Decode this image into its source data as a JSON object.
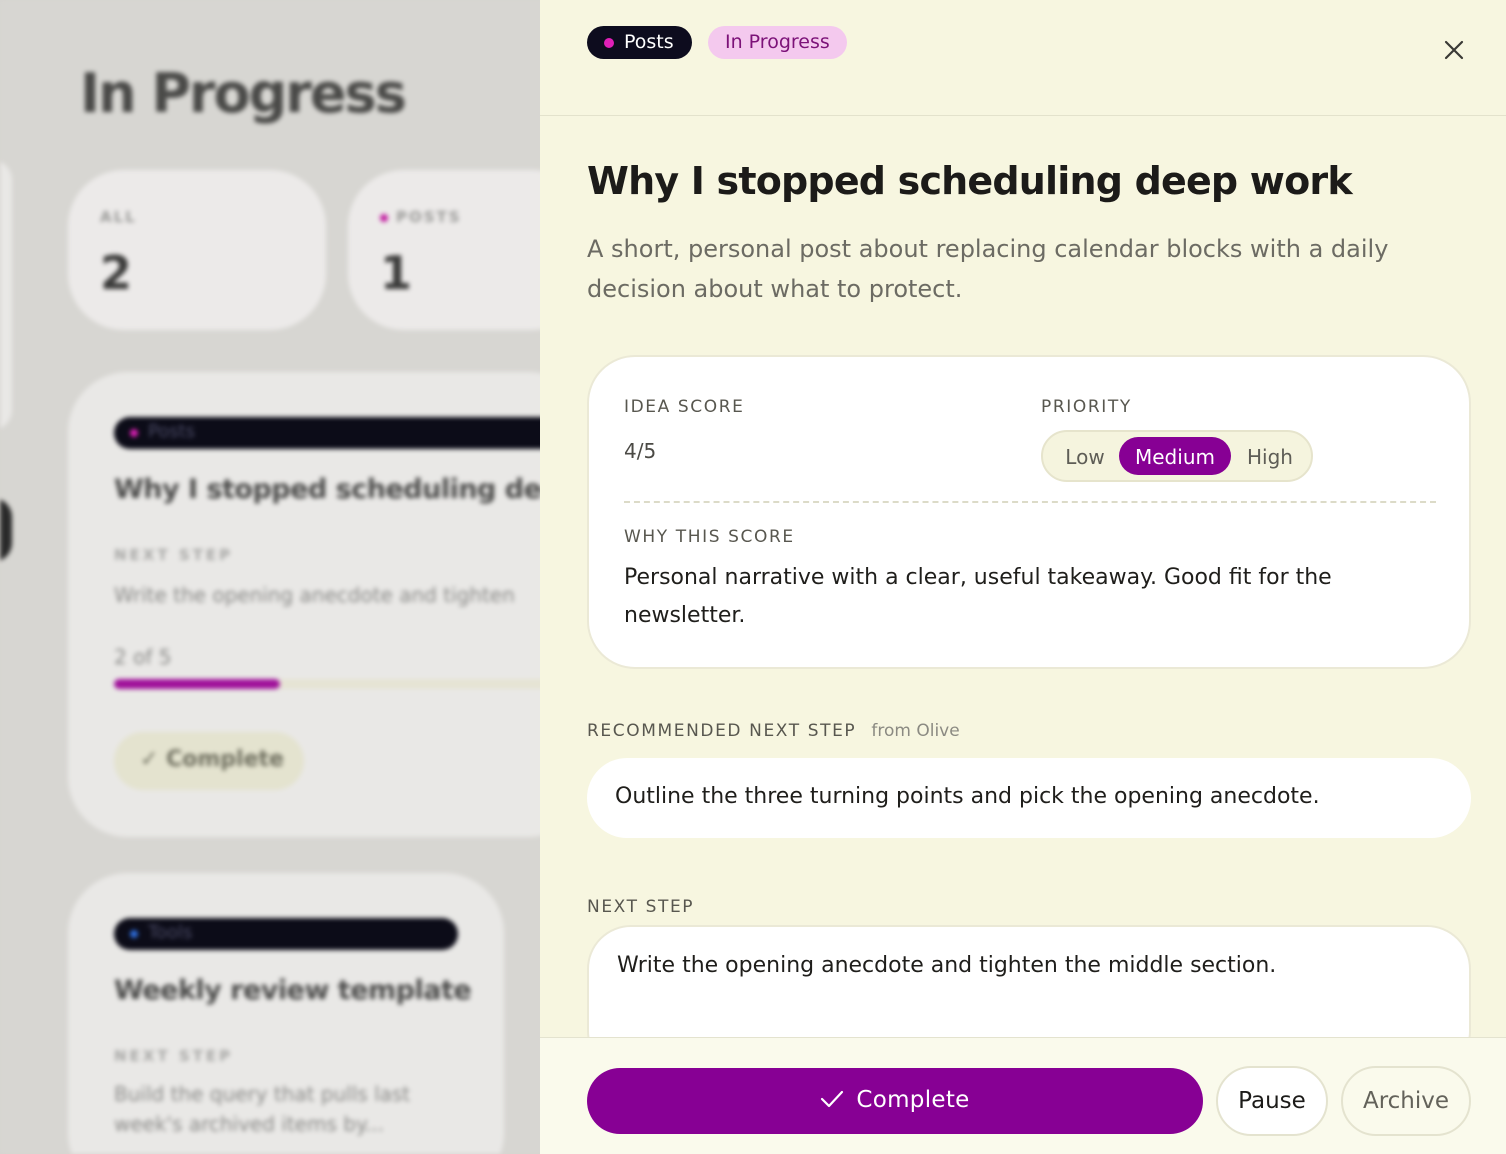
{
  "background": {
    "page_title": "In Progress",
    "stats": [
      {
        "label": "ALL",
        "value": "2"
      },
      {
        "label": "POSTS",
        "value": "1"
      }
    ],
    "cards": [
      {
        "tag": "Posts",
        "tag_color": "#e020b8",
        "title": "Why I stopped scheduling deep work",
        "caption": "NEXT STEP",
        "next_step": "Write the opening anecdote and tighten",
        "progress_text": "2 of 5",
        "progress": 0.4,
        "action": "Complete"
      },
      {
        "tag": "Tools",
        "tag_color": "#2f6fe0",
        "title": "Weekly review template",
        "caption": "NEXT STEP",
        "next_step_line1": "Build the query that pulls last",
        "next_step_line2": "week's archived items by..."
      }
    ]
  },
  "panel": {
    "tags": {
      "type": "Posts",
      "status": "In Progress"
    },
    "title": "Why I stopped scheduling deep work",
    "description": "A short, personal post about replacing calendar blocks with a daily decision about what to protect.",
    "score_card": {
      "idea_score_label": "IDEA SCORE",
      "idea_score_value": "4/5",
      "priority_label": "PRIORITY",
      "priority_options": [
        "Low",
        "Medium",
        "High"
      ],
      "priority_selected": "Medium",
      "why_label": "WHY THIS SCORE",
      "why_text": "Personal narrative with a clear, useful takeaway. Good fit for the newsletter."
    },
    "recommended": {
      "label": "RECOMMENDED NEXT STEP",
      "from": "from Olive",
      "text": "Outline the three turning points and pick the opening anecdote."
    },
    "next_step": {
      "label": "NEXT STEP",
      "value": "Write the opening anecdote and tighten the middle section."
    },
    "footer": {
      "complete": "Complete",
      "pause": "Pause",
      "archive": "Archive"
    }
  },
  "colors": {
    "accent": "#870094",
    "posts_dot": "#e020b8",
    "status_bg": "#f4c9ee",
    "panel_bg": "#f7f6e0"
  },
  "icons": [
    "close-icon",
    "check-icon"
  ]
}
